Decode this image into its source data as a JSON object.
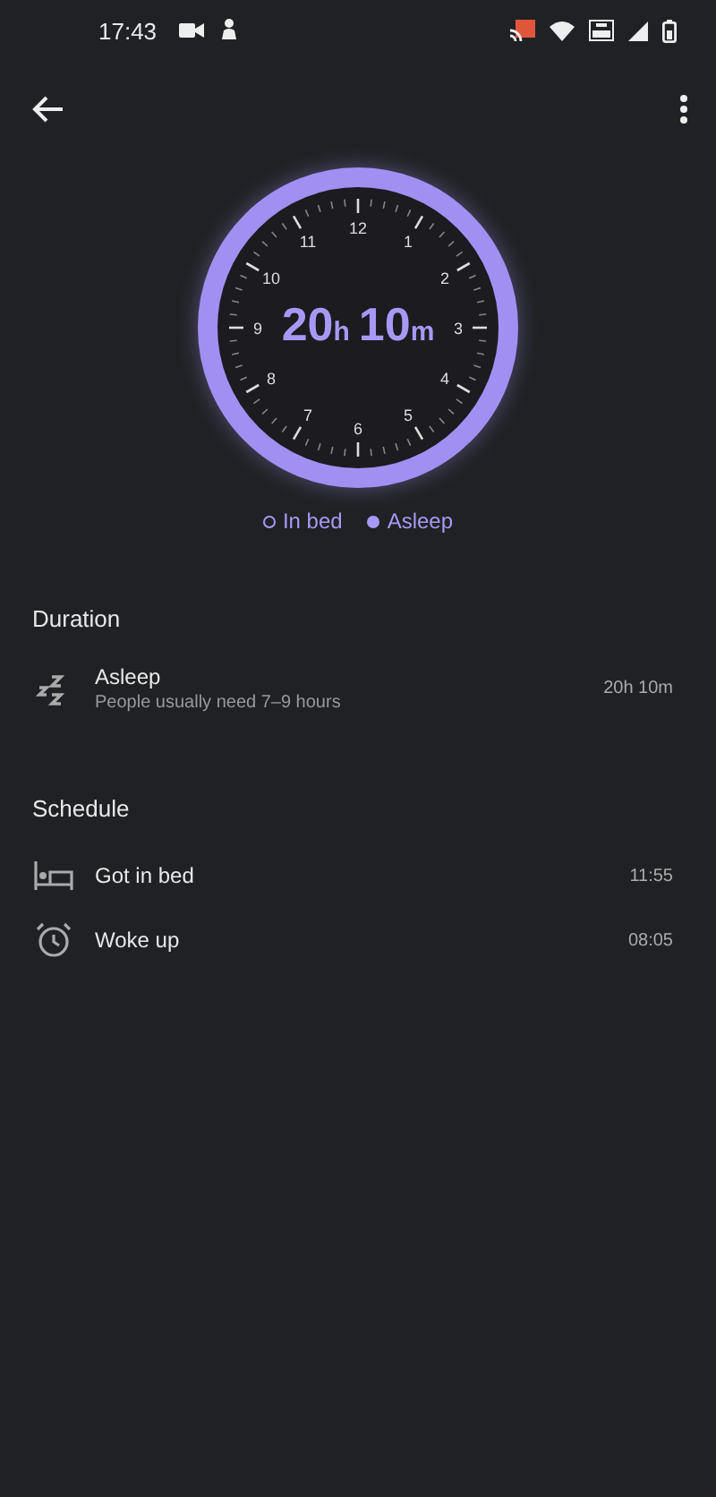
{
  "status_bar": {
    "time": "17:43"
  },
  "clock": {
    "numbers": [
      "12",
      "1",
      "2",
      "3",
      "4",
      "5",
      "6",
      "7",
      "8",
      "9",
      "10",
      "11"
    ],
    "hours": "20",
    "hours_unit": "h",
    "minutes": "10",
    "minutes_unit": "m"
  },
  "legend": [
    {
      "label": "In bed",
      "kind": "hollow"
    },
    {
      "label": "Asleep",
      "kind": "filled"
    }
  ],
  "duration": {
    "heading": "Duration",
    "rows": [
      {
        "kind": "sleep",
        "title": "Asleep",
        "subtitle": "People usually need 7–9 hours",
        "value": "20h 10m"
      }
    ]
  },
  "schedule": {
    "heading": "Schedule",
    "rows": [
      {
        "kind": "bed",
        "title": "Got in bed",
        "value": "11:55"
      },
      {
        "kind": "alarm",
        "title": "Woke up",
        "value": "08:05"
      }
    ]
  }
}
